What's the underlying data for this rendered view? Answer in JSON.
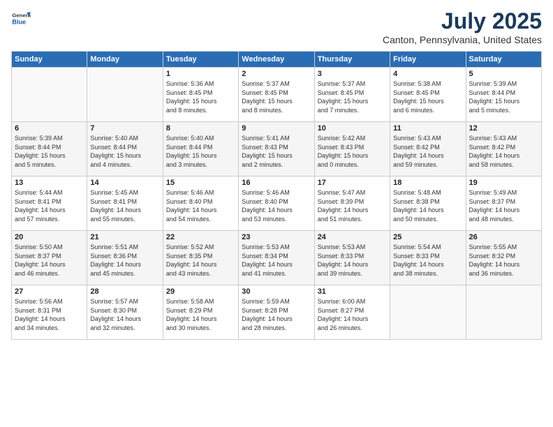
{
  "header": {
    "logo_general": "General",
    "logo_blue": "Blue",
    "title": "July 2025",
    "subtitle": "Canton, Pennsylvania, United States"
  },
  "days_of_week": [
    "Sunday",
    "Monday",
    "Tuesday",
    "Wednesday",
    "Thursday",
    "Friday",
    "Saturday"
  ],
  "weeks": [
    [
      {
        "day": "",
        "info": ""
      },
      {
        "day": "",
        "info": ""
      },
      {
        "day": "1",
        "info": "Sunrise: 5:36 AM\nSunset: 8:45 PM\nDaylight: 15 hours\nand 8 minutes."
      },
      {
        "day": "2",
        "info": "Sunrise: 5:37 AM\nSunset: 8:45 PM\nDaylight: 15 hours\nand 8 minutes."
      },
      {
        "day": "3",
        "info": "Sunrise: 5:37 AM\nSunset: 8:45 PM\nDaylight: 15 hours\nand 7 minutes."
      },
      {
        "day": "4",
        "info": "Sunrise: 5:38 AM\nSunset: 8:45 PM\nDaylight: 15 hours\nand 6 minutes."
      },
      {
        "day": "5",
        "info": "Sunrise: 5:39 AM\nSunset: 8:44 PM\nDaylight: 15 hours\nand 5 minutes."
      }
    ],
    [
      {
        "day": "6",
        "info": "Sunrise: 5:39 AM\nSunset: 8:44 PM\nDaylight: 15 hours\nand 5 minutes."
      },
      {
        "day": "7",
        "info": "Sunrise: 5:40 AM\nSunset: 8:44 PM\nDaylight: 15 hours\nand 4 minutes."
      },
      {
        "day": "8",
        "info": "Sunrise: 5:40 AM\nSunset: 8:44 PM\nDaylight: 15 hours\nand 3 minutes."
      },
      {
        "day": "9",
        "info": "Sunrise: 5:41 AM\nSunset: 8:43 PM\nDaylight: 15 hours\nand 2 minutes."
      },
      {
        "day": "10",
        "info": "Sunrise: 5:42 AM\nSunset: 8:43 PM\nDaylight: 15 hours\nand 0 minutes."
      },
      {
        "day": "11",
        "info": "Sunrise: 5:43 AM\nSunset: 8:42 PM\nDaylight: 14 hours\nand 59 minutes."
      },
      {
        "day": "12",
        "info": "Sunrise: 5:43 AM\nSunset: 8:42 PM\nDaylight: 14 hours\nand 58 minutes."
      }
    ],
    [
      {
        "day": "13",
        "info": "Sunrise: 5:44 AM\nSunset: 8:41 PM\nDaylight: 14 hours\nand 57 minutes."
      },
      {
        "day": "14",
        "info": "Sunrise: 5:45 AM\nSunset: 8:41 PM\nDaylight: 14 hours\nand 55 minutes."
      },
      {
        "day": "15",
        "info": "Sunrise: 5:46 AM\nSunset: 8:40 PM\nDaylight: 14 hours\nand 54 minutes."
      },
      {
        "day": "16",
        "info": "Sunrise: 5:46 AM\nSunset: 8:40 PM\nDaylight: 14 hours\nand 53 minutes."
      },
      {
        "day": "17",
        "info": "Sunrise: 5:47 AM\nSunset: 8:39 PM\nDaylight: 14 hours\nand 51 minutes."
      },
      {
        "day": "18",
        "info": "Sunrise: 5:48 AM\nSunset: 8:38 PM\nDaylight: 14 hours\nand 50 minutes."
      },
      {
        "day": "19",
        "info": "Sunrise: 5:49 AM\nSunset: 8:37 PM\nDaylight: 14 hours\nand 48 minutes."
      }
    ],
    [
      {
        "day": "20",
        "info": "Sunrise: 5:50 AM\nSunset: 8:37 PM\nDaylight: 14 hours\nand 46 minutes."
      },
      {
        "day": "21",
        "info": "Sunrise: 5:51 AM\nSunset: 8:36 PM\nDaylight: 14 hours\nand 45 minutes."
      },
      {
        "day": "22",
        "info": "Sunrise: 5:52 AM\nSunset: 8:35 PM\nDaylight: 14 hours\nand 43 minutes."
      },
      {
        "day": "23",
        "info": "Sunrise: 5:53 AM\nSunset: 8:34 PM\nDaylight: 14 hours\nand 41 minutes."
      },
      {
        "day": "24",
        "info": "Sunrise: 5:53 AM\nSunset: 8:33 PM\nDaylight: 14 hours\nand 39 minutes."
      },
      {
        "day": "25",
        "info": "Sunrise: 5:54 AM\nSunset: 8:33 PM\nDaylight: 14 hours\nand 38 minutes."
      },
      {
        "day": "26",
        "info": "Sunrise: 5:55 AM\nSunset: 8:32 PM\nDaylight: 14 hours\nand 36 minutes."
      }
    ],
    [
      {
        "day": "27",
        "info": "Sunrise: 5:56 AM\nSunset: 8:31 PM\nDaylight: 14 hours\nand 34 minutes."
      },
      {
        "day": "28",
        "info": "Sunrise: 5:57 AM\nSunset: 8:30 PM\nDaylight: 14 hours\nand 32 minutes."
      },
      {
        "day": "29",
        "info": "Sunrise: 5:58 AM\nSunset: 8:29 PM\nDaylight: 14 hours\nand 30 minutes."
      },
      {
        "day": "30",
        "info": "Sunrise: 5:59 AM\nSunset: 8:28 PM\nDaylight: 14 hours\nand 28 minutes."
      },
      {
        "day": "31",
        "info": "Sunrise: 6:00 AM\nSunset: 8:27 PM\nDaylight: 14 hours\nand 26 minutes."
      },
      {
        "day": "",
        "info": ""
      },
      {
        "day": "",
        "info": ""
      }
    ]
  ]
}
